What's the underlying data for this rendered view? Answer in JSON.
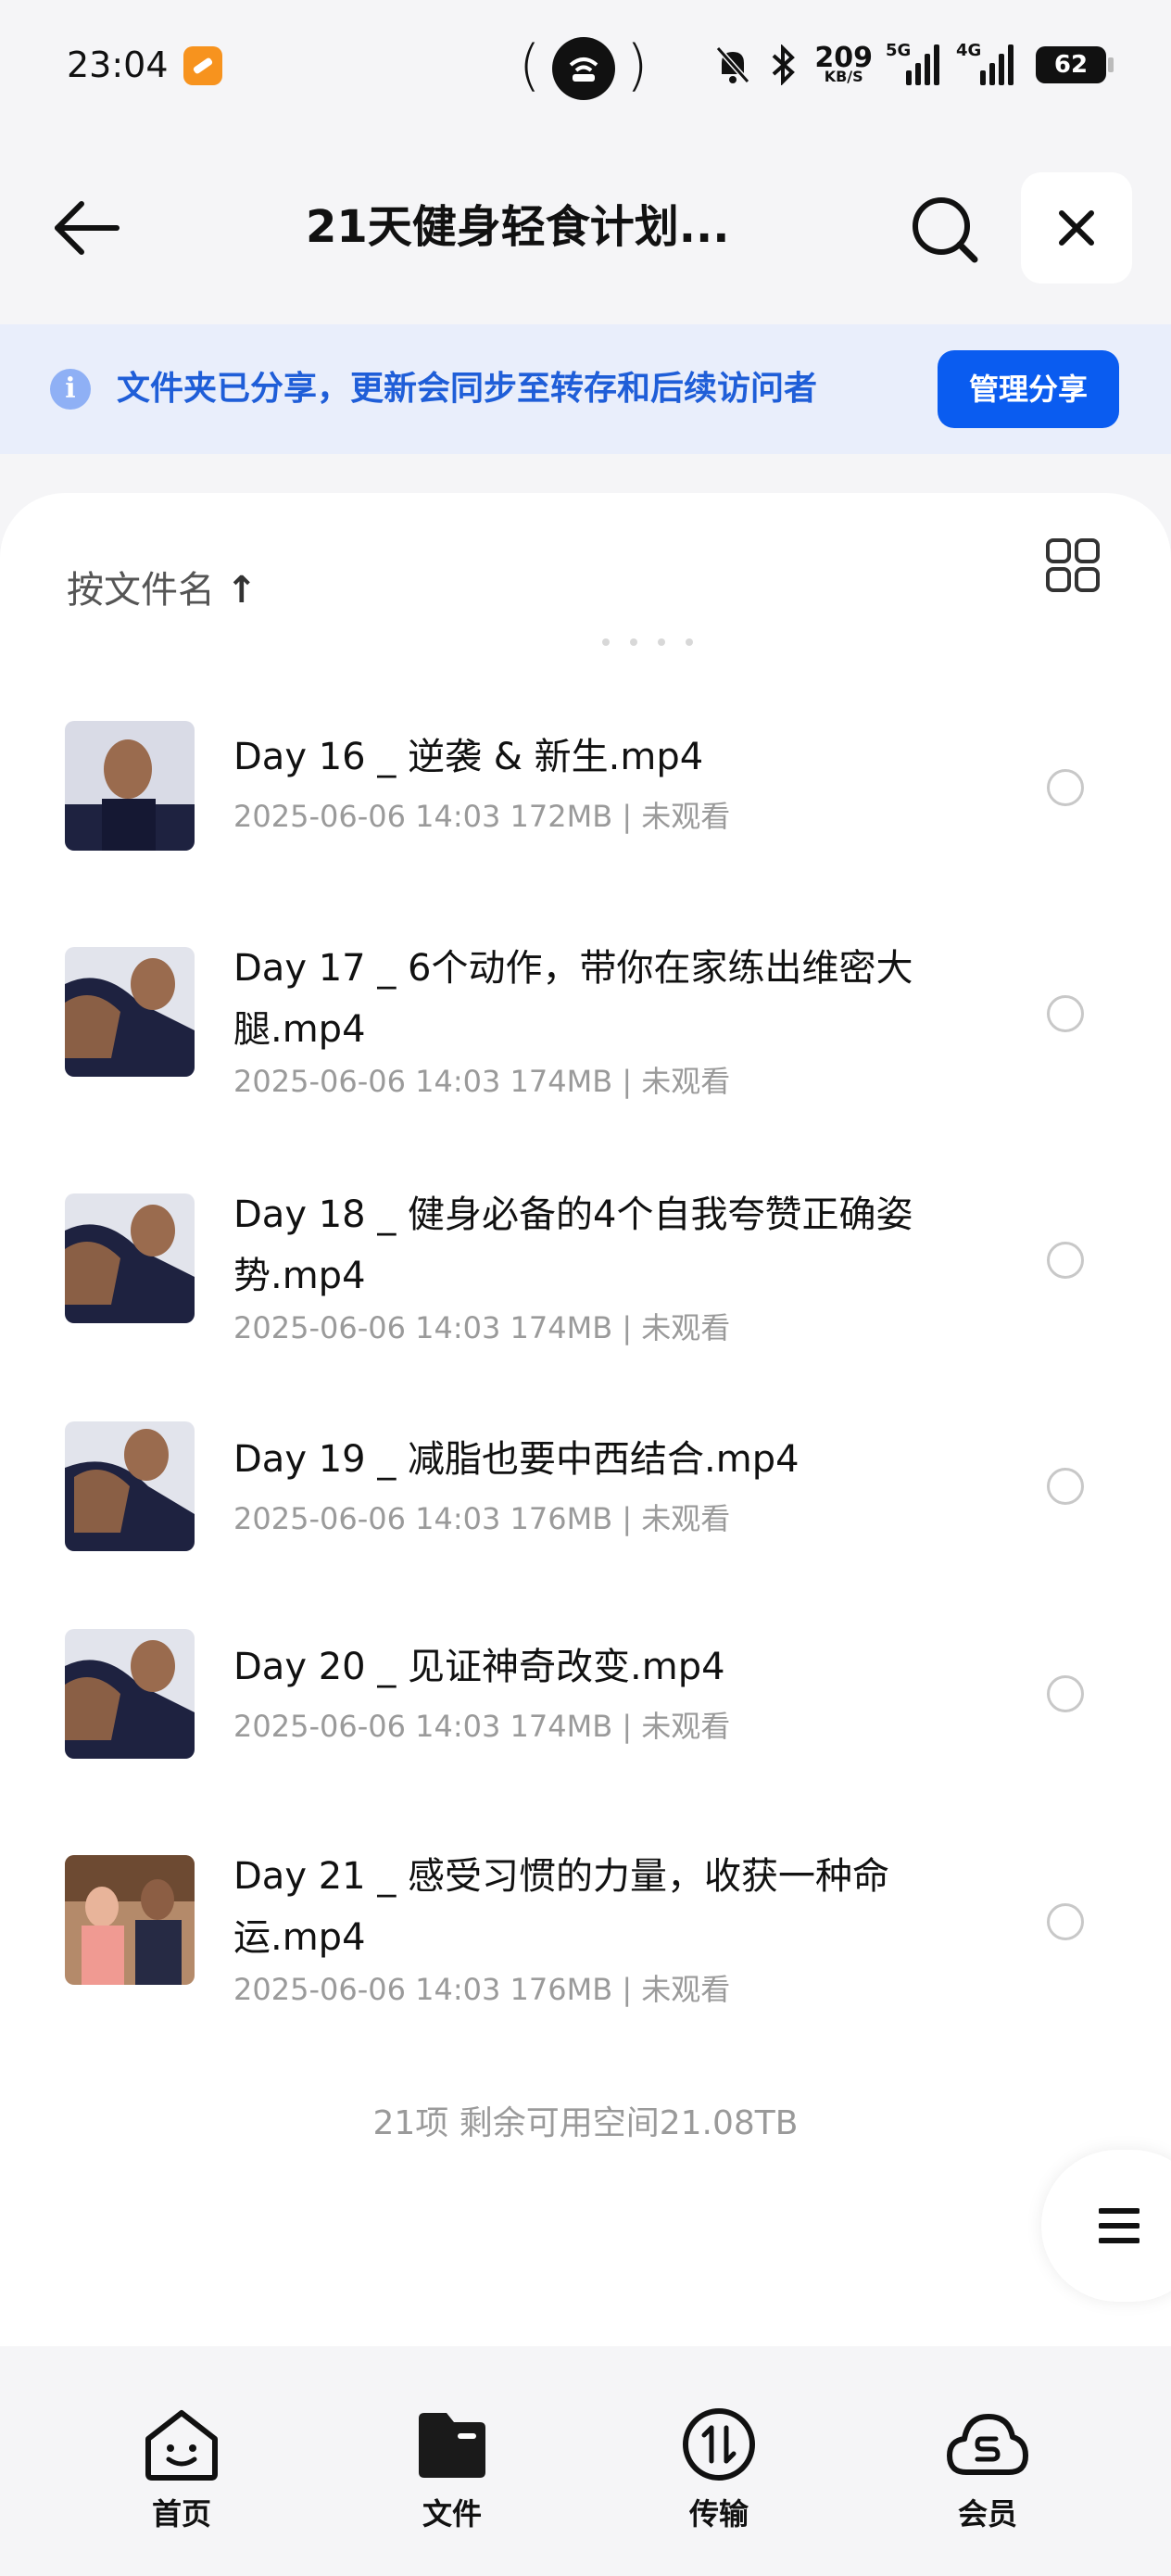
{
  "status": {
    "time": "23:04",
    "net_speed": "209",
    "net_unit": "KB/S",
    "sig1_label": "5G",
    "sig2_label": "4G",
    "battery": "62"
  },
  "nav": {
    "title": "21天健身轻食计划...",
    "back_icon": "back-arrow-icon",
    "search_icon": "search-icon",
    "close_icon": "close-icon"
  },
  "banner": {
    "text": "文件夹已分享，更新会同步至转存和后续访问者",
    "button": "管理分享",
    "accent": "#0a5cf0"
  },
  "toolbar": {
    "sort_label": "按文件名",
    "sort_arrow": "↑",
    "view_icon": "grid-view-icon"
  },
  "files": [
    {
      "name": "Day 16 _ 逆袭 & 新生.mp4",
      "meta": "2025-06-06 14:03  172MB | 未观看"
    },
    {
      "name": "Day 17 _ 6个动作，带你在家练出维密大腿.mp4",
      "meta": "2025-06-06 14:03  174MB | 未观看"
    },
    {
      "name": "Day 18 _ 健身必备的4个自我夸赞正确姿势.mp4",
      "meta": "2025-06-06 14:03  174MB | 未观看"
    },
    {
      "name": "Day 19 _ 减脂也要中西结合.mp4",
      "meta": "2025-06-06 14:03  176MB | 未观看"
    },
    {
      "name": "Day 20 _ 见证神奇改变.mp4",
      "meta": "2025-06-06 14:03  174MB | 未观看"
    },
    {
      "name": "Day 21 _ 感受习惯的力量，收获一种命运.mp4",
      "meta": "2025-06-06 14:03  176MB | 未观看"
    }
  ],
  "summary": "21项 剩余可用空间21.08TB",
  "tabs": [
    {
      "label": "首页",
      "icon": "home-face-icon"
    },
    {
      "label": "文件",
      "icon": "folder-icon"
    },
    {
      "label": "传输",
      "icon": "transfer-icon"
    },
    {
      "label": "会员",
      "icon": "member-cloud-icon"
    }
  ]
}
